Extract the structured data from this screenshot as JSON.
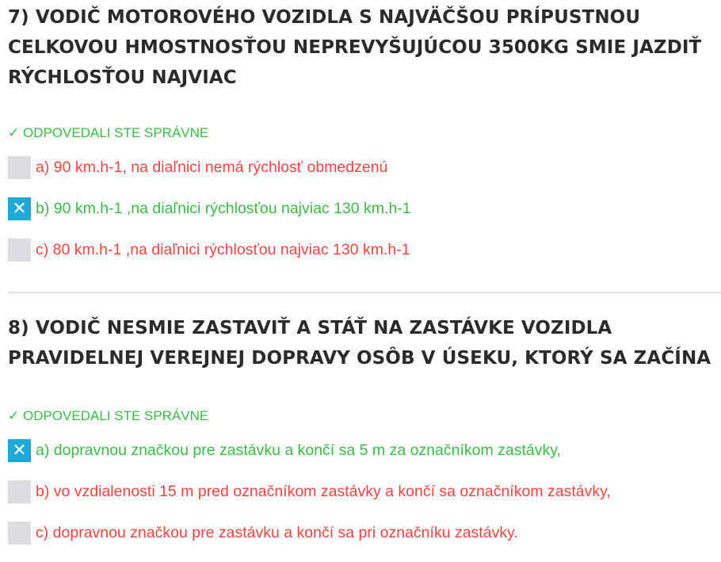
{
  "questions": [
    {
      "title": "7) VODIČ MOTOROVÉHO VOZIDLA S NAJVÄČŠOU PRÍPUSTNOU CELKOVOU HMOSTNOSŤOU NEPREVYŠUJÚCOU 3500KG SMIE JAZDIŤ RÝCHLOSŤOU NAJVIAC",
      "status": "✓ ODPOVEDALI STE SPRÁVNE",
      "answers": [
        {
          "text": "a) 90 km.h-1, na diaľnici nemá rýchlosť obmedzenú",
          "checked_mark": ""
        },
        {
          "text": "b) 90 km.h-1 ,na diaľnici rýchlosťou najviac 130 km.h-1",
          "checked_mark": "✕"
        },
        {
          "text": "c) 80 km.h-1 ,na diaľnici rýchlosťou najviac 130 km.h-1",
          "checked_mark": ""
        }
      ]
    },
    {
      "title": "8) VODIČ NESMIE ZASTAVIŤ A STÁŤ NA ZASTÁVKE VOZIDLA PRAVIDELNEJ VEREJNEJ DOPRAVY OSÔB V ÚSEKU, KTORÝ SA ZAČÍNA",
      "status": "✓ ODPOVEDALI STE SPRÁVNE",
      "answers": [
        {
          "text": "a) dopravnou značkou pre zastávku a končí sa 5 m za označníkom zastávky,",
          "checked_mark": "✕"
        },
        {
          "text": "b) vo vzdialenosti 15 m pred označníkom zastávky a končí sa označníkom zastávky,",
          "checked_mark": ""
        },
        {
          "text": "c) dopravnou značkou pre zastávku a končí sa pri označníku zastávky.",
          "checked_mark": ""
        }
      ]
    }
  ],
  "colors": {
    "correct": "#3fb84a",
    "wrong": "#ee4444",
    "checkbox_checked": "#1ea9d9",
    "checkbox_unchecked": "#dcdde0",
    "title": "#2b2b2b"
  }
}
